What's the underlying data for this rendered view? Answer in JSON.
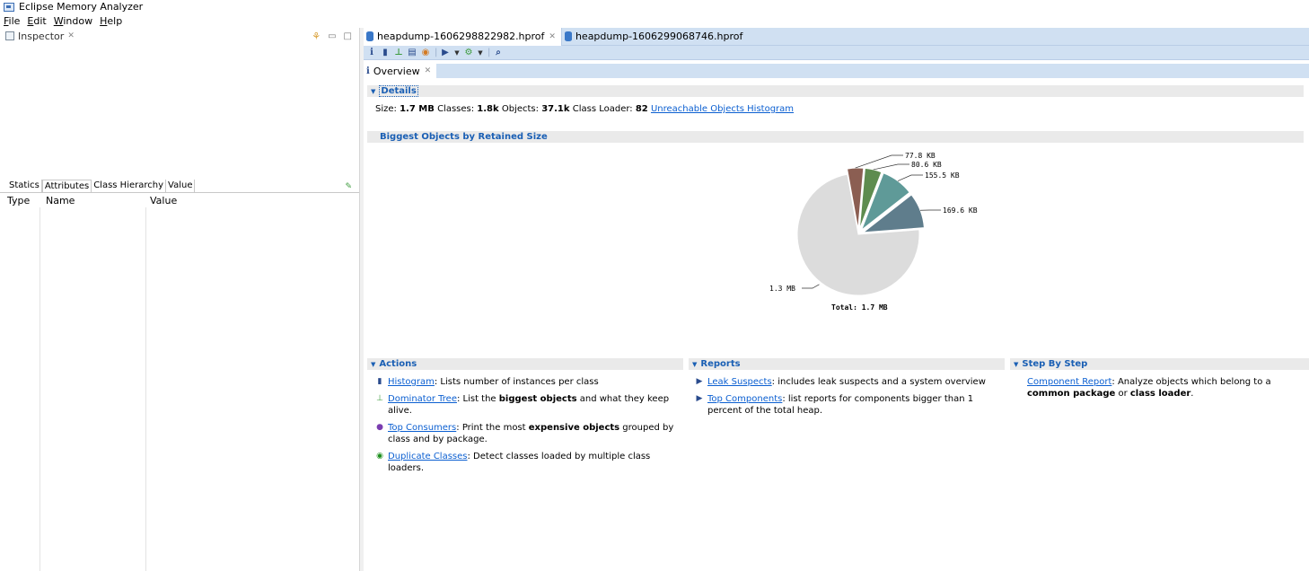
{
  "window": {
    "title": "Eclipse Memory Analyzer"
  },
  "menu": [
    "File",
    "Edit",
    "Window",
    "Help"
  ],
  "inspector": {
    "title": "Inspector",
    "close_glyph": "✗",
    "tabs": [
      "Statics",
      "Attributes",
      "Class Hierarchy",
      "Value"
    ],
    "columns": [
      "Type",
      "Name",
      "Value"
    ]
  },
  "editor": {
    "tabs": [
      {
        "label": "heapdump-1606298822982.hprof",
        "active": true
      },
      {
        "label": "heapdump-1606299068746.hprof",
        "active": false
      }
    ],
    "subtab": "Overview"
  },
  "details": {
    "header": "Details",
    "size_label": "Size:",
    "size_value": "1.7 MB",
    "classes_label": "Classes:",
    "classes_value": "1.8k",
    "objects_label": "Objects:",
    "objects_value": "37.1k",
    "loader_label": "Class Loader:",
    "loader_value": "82",
    "link": "Unreachable Objects Histogram"
  },
  "biggest": {
    "header": "Biggest Objects by Retained Size"
  },
  "chart_data": {
    "type": "pie",
    "total_label": "Total: 1.7 MB",
    "slices": [
      {
        "label": "1.3 MB",
        "value": 1331,
        "color": "#dcdcdc"
      },
      {
        "label": "169.6 KB",
        "value": 169.6,
        "color": "#5f7d8c"
      },
      {
        "label": "155.5 KB",
        "value": 155.5,
        "color": "#5f9a98"
      },
      {
        "label": "80.6 KB",
        "value": 80.6,
        "color": "#5e8c4f"
      },
      {
        "label": "77.8 KB",
        "value": 77.8,
        "color": "#8b5e52"
      }
    ]
  },
  "actions": {
    "header": "Actions",
    "items": [
      {
        "link": "Histogram",
        "pre": ": Lists number of instances per class",
        "bold": "",
        "post": ""
      },
      {
        "link": "Dominator Tree",
        "pre": ": List the ",
        "bold": "biggest objects",
        "post": " and what they keep alive."
      },
      {
        "link": "Top Consumers",
        "pre": ": Print the most ",
        "bold": "expensive objects",
        "post": " grouped by class and by package."
      },
      {
        "link": "Duplicate Classes",
        "pre": ": Detect classes loaded by multiple class loaders.",
        "bold": "",
        "post": ""
      }
    ]
  },
  "reports": {
    "header": "Reports",
    "items": [
      {
        "link": "Leak Suspects",
        "text": ": includes leak suspects and a system overview"
      },
      {
        "link": "Top Components",
        "text": ": list reports for components bigger than 1 percent of the total heap."
      }
    ]
  },
  "stepbystep": {
    "header": "Step By Step",
    "link": "Component Report",
    "text1": ": Analyze objects which belong to a ",
    "bold1": "common package",
    "text2": " or ",
    "bold2": "class loader",
    "text3": "."
  }
}
